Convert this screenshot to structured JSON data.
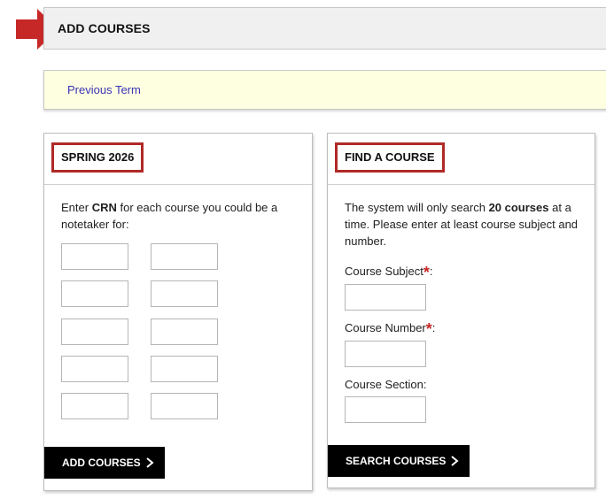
{
  "header": {
    "title": "ADD COURSES",
    "arrow_color": "#c62828"
  },
  "term_bar": {
    "link_label": "Previous Term"
  },
  "left_panel": {
    "title": "SPRING 2026",
    "intro_before": "Enter ",
    "intro_bold": "CRN",
    "intro_after": " for each course you could be a notetaker for:",
    "crn_values": [
      "",
      "",
      "",
      "",
      "",
      "",
      "",
      "",
      "",
      ""
    ],
    "button_label": "ADD COURSES",
    "button_icon": "chevron-right-icon"
  },
  "right_panel": {
    "title": "FIND A COURSE",
    "intro_before": "The system will only search ",
    "intro_bold": "20 courses",
    "intro_after": " at a time. Please enter at least course subject and number.",
    "subject_label": "Course Subject",
    "number_label": "Course Number",
    "section_label": "Course Section:",
    "required_mark": "*",
    "colon": ":",
    "subject_value": "",
    "number_value": "",
    "section_value": "",
    "button_label": "SEARCH COURSES",
    "button_icon": "chevron-right-icon"
  },
  "colors": {
    "accent": "#b02a27",
    "link": "#3a35b8",
    "term_bg": "#fefee0"
  }
}
